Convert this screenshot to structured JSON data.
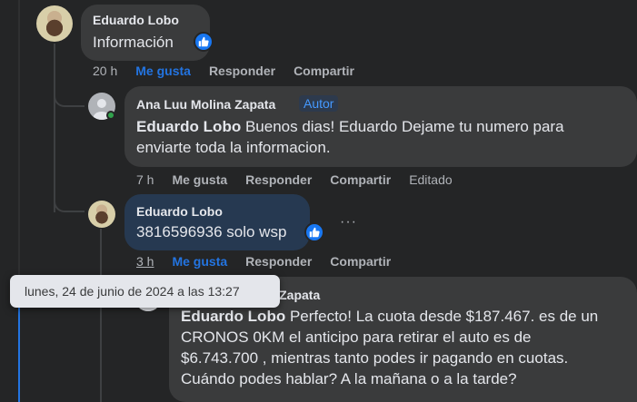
{
  "comments": [
    {
      "author": "Eduardo Lobo",
      "text": "Información",
      "time": "20 h",
      "like": "Me gusta",
      "reply": "Responder",
      "share": "Compartir"
    },
    {
      "author": "Ana Luu Molina Zapata",
      "badge": "Autor",
      "mention": "Eduardo Lobo",
      "text_line1": " Buenos dias! Eduardo Dejame tu numero para",
      "text_line2": "enviarte toda la informacion.",
      "time": "7 h",
      "like": "Me gusta",
      "reply": "Responder",
      "share": "Compartir",
      "edited": "Editado"
    },
    {
      "author": "Eduardo Lobo",
      "text": "3816596936 solo wsp",
      "time": "3 h",
      "like": "Me gusta",
      "reply": "Responder",
      "share": "Compartir",
      "more": "···"
    },
    {
      "author": "Ana Luu Molina Zapata",
      "mention": "Eduardo Lobo",
      "text_line1": " Perfecto! La cuota desde $187.467. es de un",
      "text_line2": "CRONOS 0KM el anticipo para retirar el auto es de",
      "text_line3": "$6.743.700 , mientras tanto podes ir pagando en cuotas.",
      "text_line4": "Cuándo podes hablar? A la mañana o a la tarde?"
    }
  ],
  "tooltip": "lunes, 24 de junio de 2024 a las 13:27",
  "colors": {
    "background": "#242526",
    "bubble": "#3a3b3c",
    "bubble_selected": "#263951",
    "link_blue": "#2374e1",
    "like_icon": "#1877f2",
    "author_badge": "#4599ff"
  },
  "icons": [
    "like-reaction-icon",
    "more-options-icon",
    "avatar",
    "online-status-dot"
  ]
}
